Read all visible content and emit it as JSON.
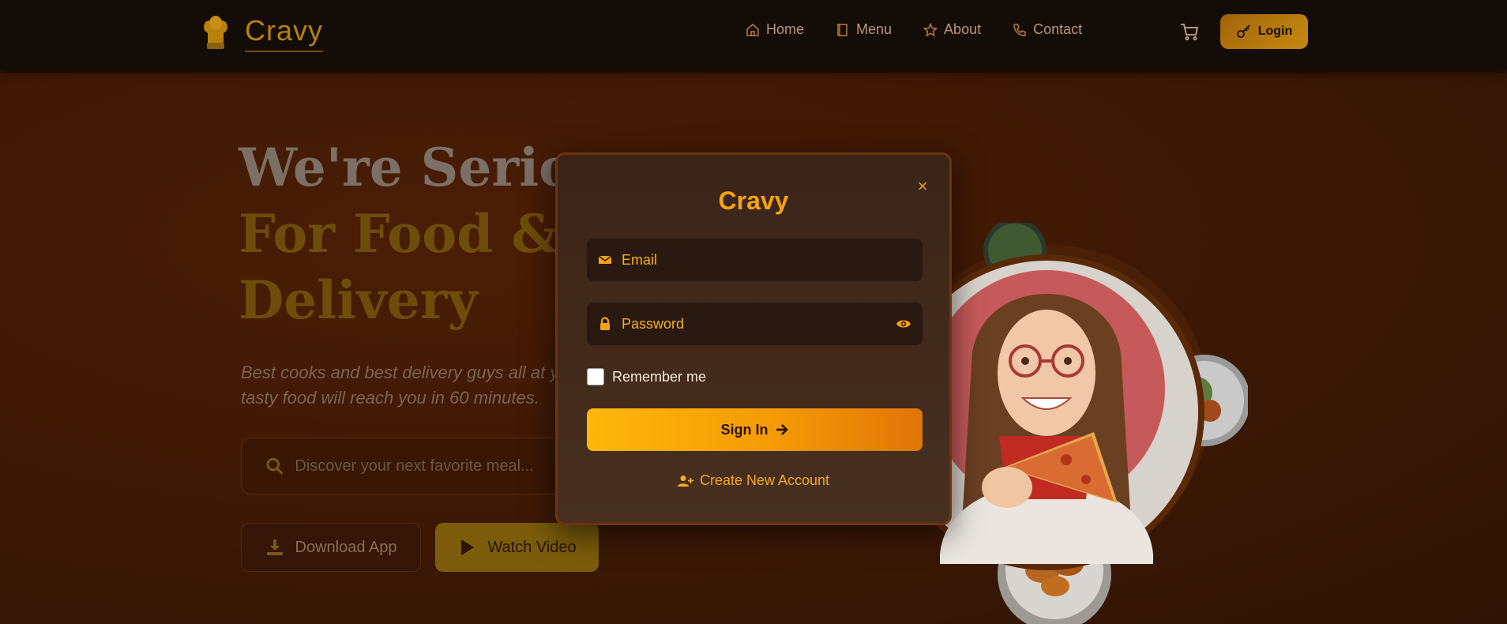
{
  "brand": {
    "name": "Cravy",
    "logo_icon": "chef-hat-icon"
  },
  "nav": {
    "links": [
      {
        "label": "Home",
        "icon": "home-icon"
      },
      {
        "label": "Menu",
        "icon": "book-icon"
      },
      {
        "label": "About",
        "icon": "star-icon"
      },
      {
        "label": "Contact",
        "icon": "phone-icon"
      }
    ],
    "cart_icon": "cart-icon",
    "login_label": "Login",
    "login_icon": "key-icon"
  },
  "hero": {
    "title_line1": "We're Serio",
    "title_line2": "For Food &",
    "title_line3": "Delivery",
    "subtitle": "Best cooks and best delivery guys all at yo tasty food will reach you in 60 minutes.",
    "search_placeholder": "Discover your next favorite meal...",
    "download_label": "Download App",
    "watch_label": "Watch Video"
  },
  "modal": {
    "title": "Cravy",
    "close_symbol": "×",
    "email_placeholder": "Email",
    "password_placeholder": "Password",
    "remember_label": "Remember me",
    "remember_checked": false,
    "signin_label": "Sign In",
    "create_account_label": "Create New Account"
  },
  "colors": {
    "accent": "#f5a312",
    "navbar_bg": "#140c07",
    "hero_bg": "#3b1805",
    "modal_bg": "#3a2418",
    "field_bg": "#2a1910"
  }
}
